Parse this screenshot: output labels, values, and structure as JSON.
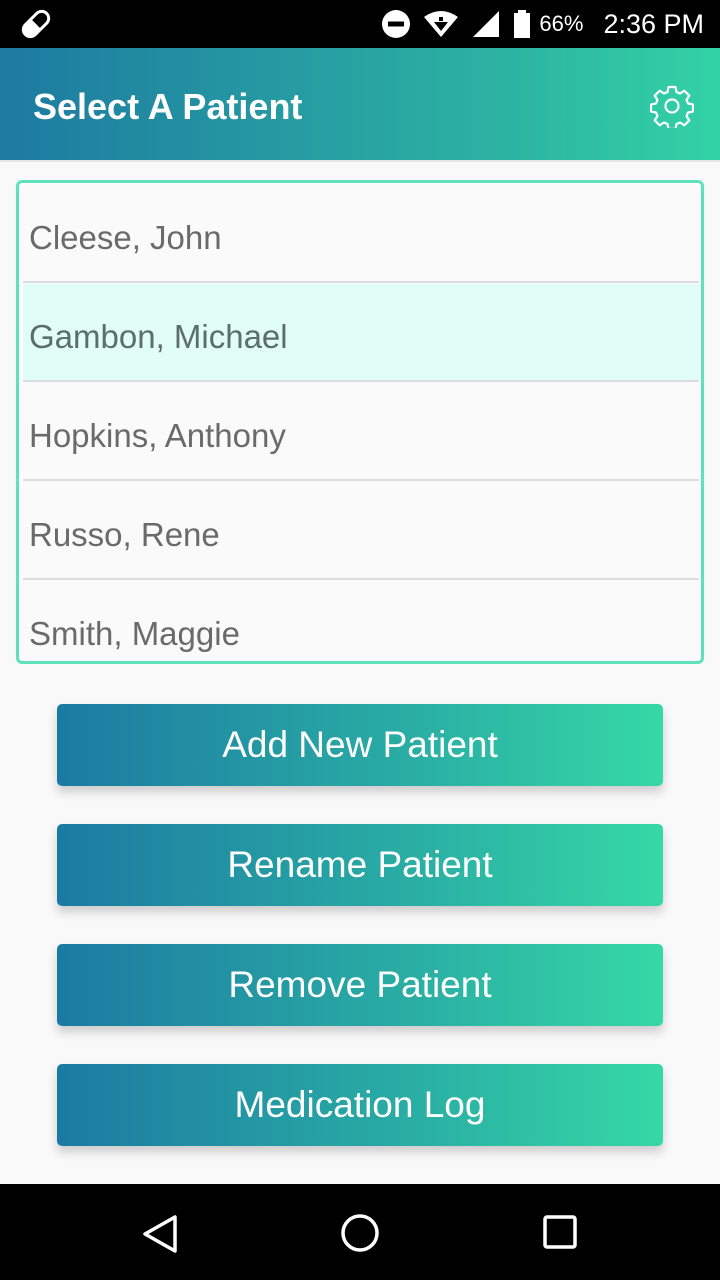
{
  "status_bar": {
    "battery_percent": "66%",
    "time": "2:36 PM"
  },
  "app_bar": {
    "title": "Select A Patient",
    "settings_icon": "gear-icon"
  },
  "patients": [
    {
      "name": "Cleese, John"
    },
    {
      "name": "Gambon, Michael",
      "selected": true
    },
    {
      "name": "Hopkins, Anthony"
    },
    {
      "name": "Russo, Rene"
    },
    {
      "name": "Smith, Maggie"
    }
  ],
  "buttons": {
    "add_new_patient": "Add New Patient",
    "rename_patient": "Rename Patient",
    "remove_patient": "Remove Patient",
    "medication_log": "Medication Log"
  },
  "colors": {
    "accent_start": "#1d7aa1",
    "accent_end": "#33d2a6",
    "list_border": "#5fe2b9",
    "selected_row": "#e0fdf6"
  },
  "nav_bar": {
    "icons": [
      "back-triangle-icon",
      "home-circle-icon",
      "recents-square-icon"
    ]
  }
}
